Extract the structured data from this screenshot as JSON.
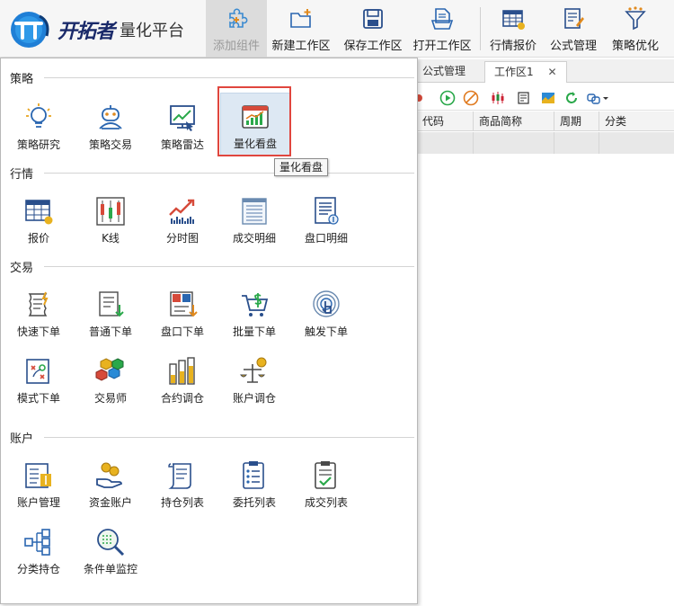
{
  "app": {
    "logo_text": "开拓者",
    "logo_sub": "量化平台"
  },
  "toolbar": {
    "items": [
      {
        "label": "添加组件",
        "icon": "puzzle-plus-icon",
        "active": true
      },
      {
        "label": "新建工作区",
        "icon": "folder-new-icon"
      },
      {
        "label": "保存工作区",
        "icon": "save-icon"
      },
      {
        "label": "打开工作区",
        "icon": "open-doc-icon"
      },
      {
        "label": "行情报价",
        "icon": "quote-table-icon"
      },
      {
        "label": "公式管理",
        "icon": "formula-edit-icon"
      },
      {
        "label": "策略优化",
        "icon": "funnel-optimize-icon"
      }
    ]
  },
  "workspace": {
    "tabs": [
      {
        "label": "公式管理"
      },
      {
        "label": "工作区1",
        "close": "✕",
        "active": true
      }
    ],
    "grid_columns": [
      "代码",
      "商品简称",
      "周期",
      "分类"
    ]
  },
  "panel": {
    "sections": [
      {
        "title": "策略",
        "items": [
          {
            "label": "策略研究",
            "icon": "bulb-icon"
          },
          {
            "label": "策略交易",
            "icon": "robot-icon"
          },
          {
            "label": "策略雷达",
            "icon": "radar-chart-icon"
          },
          {
            "label": "量化看盘",
            "icon": "trend-board-icon",
            "selected": true
          }
        ]
      },
      {
        "title": "行情",
        "items": [
          {
            "label": "报价",
            "icon": "price-table-icon"
          },
          {
            "label": "K线",
            "icon": "candlestick-icon"
          },
          {
            "label": "分时图",
            "icon": "intraday-chart-icon"
          },
          {
            "label": "成交明细",
            "icon": "trade-detail-icon"
          },
          {
            "label": "盘口明细",
            "icon": "orderbook-detail-icon"
          }
        ]
      },
      {
        "title": "交易",
        "items": [
          {
            "label": "快速下单",
            "icon": "quick-order-icon"
          },
          {
            "label": "普通下单",
            "icon": "normal-order-icon"
          },
          {
            "label": "盘口下单",
            "icon": "bs-order-icon"
          },
          {
            "label": "批量下单",
            "icon": "cart-dollar-icon"
          },
          {
            "label": "触发下单",
            "icon": "touch-trigger-icon"
          },
          {
            "label": "模式下单",
            "icon": "pattern-order-icon"
          },
          {
            "label": "交易师",
            "icon": "cubes-icon"
          },
          {
            "label": "合约调仓",
            "icon": "contract-rebalance-icon"
          },
          {
            "label": "账户调仓",
            "icon": "account-rebalance-icon"
          }
        ]
      },
      {
        "title": "账户",
        "items": [
          {
            "label": "账户管理",
            "icon": "account-manage-icon"
          },
          {
            "label": "资金账户",
            "icon": "coin-hand-icon"
          },
          {
            "label": "持仓列表",
            "icon": "position-scroll-icon"
          },
          {
            "label": "委托列表",
            "icon": "order-list-icon"
          },
          {
            "label": "成交列表",
            "icon": "filled-list-icon"
          },
          {
            "label": "分类持仓",
            "icon": "category-tree-icon"
          },
          {
            "label": "条件单监控",
            "icon": "condition-monitor-icon"
          }
        ]
      }
    ],
    "tooltip": "量化看盘"
  },
  "colors": {
    "highlight": "#e0463e",
    "brand_blue": "#1f7fd6",
    "play_green": "#2aa84a",
    "stop_orange": "#e07a1f"
  }
}
